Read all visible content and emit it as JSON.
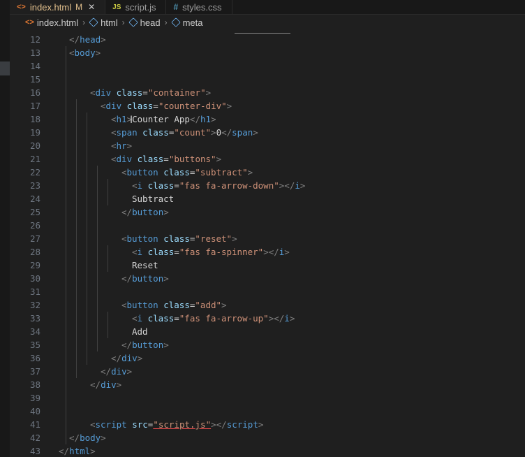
{
  "tabs": [
    {
      "label": "index.html",
      "badge": "M",
      "icon": "html-file-icon",
      "active": true
    },
    {
      "label": "script.js",
      "icon": "js-file-icon"
    },
    {
      "label": "styles.css",
      "icon": "css-file-icon"
    }
  ],
  "tab_icons": {
    "html": "<>",
    "js": "JS",
    "css": "#"
  },
  "breadcrumb": [
    "index.html",
    "html",
    "head",
    "meta"
  ],
  "colors": {
    "tag": "#569cd6",
    "attr": "#9cdcfe",
    "string": "#ce9178",
    "text": "#d4d4d4",
    "bracket": "#808080",
    "line_number": "#6e7681",
    "modified": "#e2c08d"
  },
  "lines": [
    {
      "n": "12",
      "t": [
        [
          "</",
          "br"
        ],
        [
          "head",
          "tag"
        ],
        [
          ">",
          "br"
        ]
      ]
    },
    {
      "n": "13",
      "t": [
        [
          "<",
          "br"
        ],
        [
          "body",
          "tag"
        ],
        [
          ">",
          "br"
        ]
      ]
    },
    {
      "n": "14",
      "t": []
    },
    {
      "n": "15",
      "t": []
    },
    {
      "n": "16",
      "t": [
        [
          "<",
          "br"
        ],
        [
          "div",
          "tag"
        ],
        [
          " ",
          "text"
        ],
        [
          "class",
          "attr"
        ],
        [
          "=",
          "eq"
        ],
        [
          "\"container\"",
          "str"
        ],
        [
          ">",
          "br"
        ]
      ]
    },
    {
      "n": "17",
      "t": [
        [
          "<",
          "br"
        ],
        [
          "div",
          "tag"
        ],
        [
          " ",
          "text"
        ],
        [
          "class",
          "attr"
        ],
        [
          "=",
          "eq"
        ],
        [
          "\"counter-div\"",
          "str"
        ],
        [
          ">",
          "br"
        ]
      ]
    },
    {
      "n": "18",
      "t": [
        [
          "<",
          "br"
        ],
        [
          "h1",
          "tag"
        ],
        [
          ">",
          "br"
        ],
        [
          "Counter App",
          "text"
        ],
        [
          "</",
          "br"
        ],
        [
          "h1",
          "tag"
        ],
        [
          ">",
          "br"
        ]
      ]
    },
    {
      "n": "19",
      "t": [
        [
          "<",
          "br"
        ],
        [
          "span",
          "tag"
        ],
        [
          " ",
          "text"
        ],
        [
          "class",
          "attr"
        ],
        [
          "=",
          "eq"
        ],
        [
          "\"count\"",
          "str"
        ],
        [
          ">",
          "br"
        ],
        [
          "0",
          "text"
        ],
        [
          "</",
          "br"
        ],
        [
          "span",
          "tag"
        ],
        [
          ">",
          "br"
        ]
      ]
    },
    {
      "n": "20",
      "t": [
        [
          "<",
          "br"
        ],
        [
          "hr",
          "tag"
        ],
        [
          ">",
          "br"
        ]
      ]
    },
    {
      "n": "21",
      "t": [
        [
          "<",
          "br"
        ],
        [
          "div",
          "tag"
        ],
        [
          " ",
          "text"
        ],
        [
          "class",
          "attr"
        ],
        [
          "=",
          "eq"
        ],
        [
          "\"buttons\"",
          "str"
        ],
        [
          ">",
          "br"
        ]
      ]
    },
    {
      "n": "22",
      "t": [
        [
          "<",
          "br"
        ],
        [
          "button",
          "tag"
        ],
        [
          " ",
          "text"
        ],
        [
          "class",
          "attr"
        ],
        [
          "=",
          "eq"
        ],
        [
          "\"subtract\"",
          "str"
        ],
        [
          ">",
          "br"
        ]
      ]
    },
    {
      "n": "23",
      "t": [
        [
          "<",
          "br"
        ],
        [
          "i",
          "tag"
        ],
        [
          " ",
          "text"
        ],
        [
          "class",
          "attr"
        ],
        [
          "=",
          "eq"
        ],
        [
          "\"fas fa-arrow-down\"",
          "str"
        ],
        [
          "></",
          "br"
        ],
        [
          "i",
          "tag"
        ],
        [
          ">",
          "br"
        ]
      ]
    },
    {
      "n": "24",
      "t": [
        [
          "Subtract",
          "text"
        ]
      ]
    },
    {
      "n": "25",
      "t": [
        [
          "</",
          "br"
        ],
        [
          "button",
          "tag"
        ],
        [
          ">",
          "br"
        ]
      ]
    },
    {
      "n": "26",
      "t": []
    },
    {
      "n": "27",
      "t": [
        [
          "<",
          "br"
        ],
        [
          "button",
          "tag"
        ],
        [
          " ",
          "text"
        ],
        [
          "class",
          "attr"
        ],
        [
          "=",
          "eq"
        ],
        [
          "\"reset\"",
          "str"
        ],
        [
          ">",
          "br"
        ]
      ]
    },
    {
      "n": "28",
      "t": [
        [
          "<",
          "br"
        ],
        [
          "i",
          "tag"
        ],
        [
          " ",
          "text"
        ],
        [
          "class",
          "attr"
        ],
        [
          "=",
          "eq"
        ],
        [
          "\"fas fa-spinner\"",
          "str"
        ],
        [
          "></",
          "br"
        ],
        [
          "i",
          "tag"
        ],
        [
          ">",
          "br"
        ]
      ]
    },
    {
      "n": "29",
      "t": [
        [
          "Reset",
          "text"
        ]
      ]
    },
    {
      "n": "30",
      "t": [
        [
          "</",
          "br"
        ],
        [
          "button",
          "tag"
        ],
        [
          ">",
          "br"
        ]
      ]
    },
    {
      "n": "31",
      "t": []
    },
    {
      "n": "32",
      "t": [
        [
          "<",
          "br"
        ],
        [
          "button",
          "tag"
        ],
        [
          " ",
          "text"
        ],
        [
          "class",
          "attr"
        ],
        [
          "=",
          "eq"
        ],
        [
          "\"add\"",
          "str"
        ],
        [
          ">",
          "br"
        ]
      ]
    },
    {
      "n": "33",
      "t": [
        [
          "<",
          "br"
        ],
        [
          "i",
          "tag"
        ],
        [
          " ",
          "text"
        ],
        [
          "class",
          "attr"
        ],
        [
          "=",
          "eq"
        ],
        [
          "\"fas fa-arrow-up\"",
          "str"
        ],
        [
          "></",
          "br"
        ],
        [
          "i",
          "tag"
        ],
        [
          ">",
          "br"
        ]
      ]
    },
    {
      "n": "34",
      "t": [
        [
          "Add",
          "text"
        ]
      ]
    },
    {
      "n": "35",
      "t": [
        [
          "</",
          "br"
        ],
        [
          "button",
          "tag"
        ],
        [
          ">",
          "br"
        ]
      ]
    },
    {
      "n": "36",
      "t": [
        [
          "</",
          "br"
        ],
        [
          "div",
          "tag"
        ],
        [
          ">",
          "br"
        ]
      ]
    },
    {
      "n": "37",
      "t": [
        [
          "</",
          "br"
        ],
        [
          "div",
          "tag"
        ],
        [
          ">",
          "br"
        ]
      ]
    },
    {
      "n": "38",
      "t": [
        [
          "</",
          "br"
        ],
        [
          "div",
          "tag"
        ],
        [
          ">",
          "br"
        ]
      ]
    },
    {
      "n": "39",
      "t": []
    },
    {
      "n": "40",
      "t": []
    },
    {
      "n": "41",
      "t": [
        [
          "<",
          "br"
        ],
        [
          "script",
          "tag"
        ],
        [
          " ",
          "text"
        ],
        [
          "src",
          "attr"
        ],
        [
          "=",
          "eq"
        ],
        [
          "\"script.js\"",
          "str_link"
        ],
        [
          "></",
          "br"
        ],
        [
          "script",
          "tag"
        ],
        [
          ">",
          "br"
        ]
      ]
    },
    {
      "n": "42",
      "t": [
        [
          "</",
          "br"
        ],
        [
          "body",
          "tag"
        ],
        [
          ">",
          "br"
        ]
      ]
    },
    {
      "n": "43",
      "t": [
        [
          "</",
          "br"
        ],
        [
          "html",
          "tag"
        ],
        [
          ">",
          "br"
        ]
      ]
    }
  ]
}
